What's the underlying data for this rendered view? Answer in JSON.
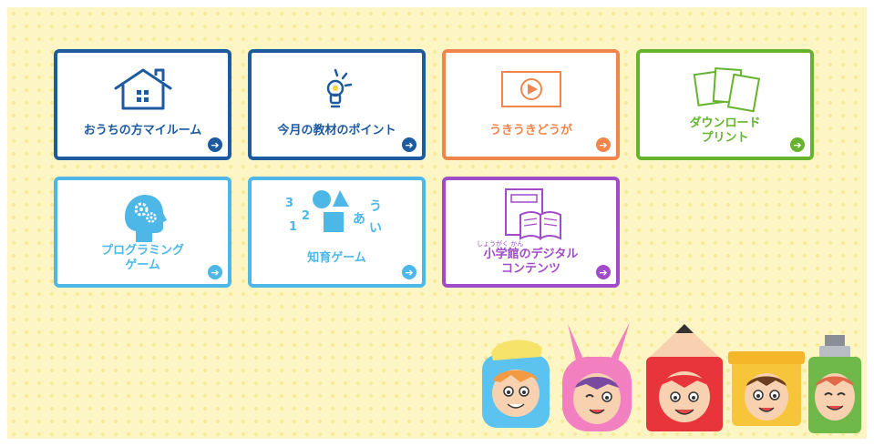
{
  "menu": {
    "cards": [
      {
        "id": "home",
        "label": "おうちの方マイルーム",
        "icon": "house-icon",
        "color": "#1d5aa0"
      },
      {
        "id": "points",
        "label": "今月の教材のポイント",
        "icon": "lightbulb-icon",
        "color": "#1d5aa0"
      },
      {
        "id": "videos",
        "label": "うきうきどうが",
        "icon": "play-video-icon",
        "color": "#f0854d"
      },
      {
        "id": "download",
        "label_line1": "ダウンロード",
        "label_line2": "プリント",
        "icon": "papers-icon",
        "color": "#66b32e"
      },
      {
        "id": "programming",
        "label_line1": "プログラミング",
        "label_line2": "ゲーム",
        "icon": "gear-head-icon",
        "color": "#4db8e8"
      },
      {
        "id": "intellect",
        "label": "知育ゲーム",
        "icon": "shapes-numbers-icon",
        "color": "#4db8e8",
        "icon_chars": [
          "3",
          "2",
          "1",
          "あ",
          "う",
          "い"
        ]
      },
      {
        "id": "digital",
        "ruby": "しょうがく かん",
        "label_line1": "小学館のデジタル",
        "label_line2": "コンテンツ",
        "icon": "book-icon",
        "color": "#a04bc8"
      }
    ],
    "arrow_glyph": "➔"
  },
  "mascots": [
    "blue-character",
    "pink-bunny-character",
    "red-pencil-character",
    "yellow-character",
    "green-tube-character"
  ]
}
